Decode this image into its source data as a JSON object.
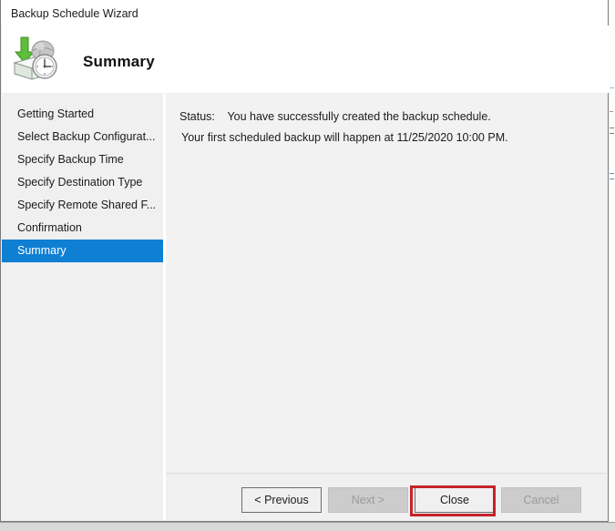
{
  "window": {
    "title": "Backup Schedule Wizard"
  },
  "header": {
    "page_title": "Summary",
    "icon": "backup-schedule-icon"
  },
  "sidebar": {
    "items": [
      {
        "label": "Getting Started",
        "selected": false
      },
      {
        "label": "Select Backup Configurat...",
        "selected": false
      },
      {
        "label": "Specify Backup Time",
        "selected": false
      },
      {
        "label": "Specify Destination Type",
        "selected": false
      },
      {
        "label": "Specify Remote Shared F...",
        "selected": false
      },
      {
        "label": "Confirmation",
        "selected": false
      },
      {
        "label": "Summary",
        "selected": true
      }
    ]
  },
  "content": {
    "status_label": "Status:",
    "status_value": "You have successfully created the backup schedule.",
    "status_detail": "Your first scheduled backup will happen at 11/25/2020 10:00 PM."
  },
  "buttons": {
    "previous": "< Previous",
    "next": "Next >",
    "close": "Close",
    "cancel": "Cancel"
  },
  "background": {
    "bottom_text_left": "",
    "bottom_text_right": ""
  },
  "colors": {
    "accent_blue": "#0f7fd4",
    "annotation_red": "#c5232b",
    "dialog_bg": "#f0f0f0",
    "content_bg": "#f2f2f2",
    "header_bg": "#ffffff"
  }
}
